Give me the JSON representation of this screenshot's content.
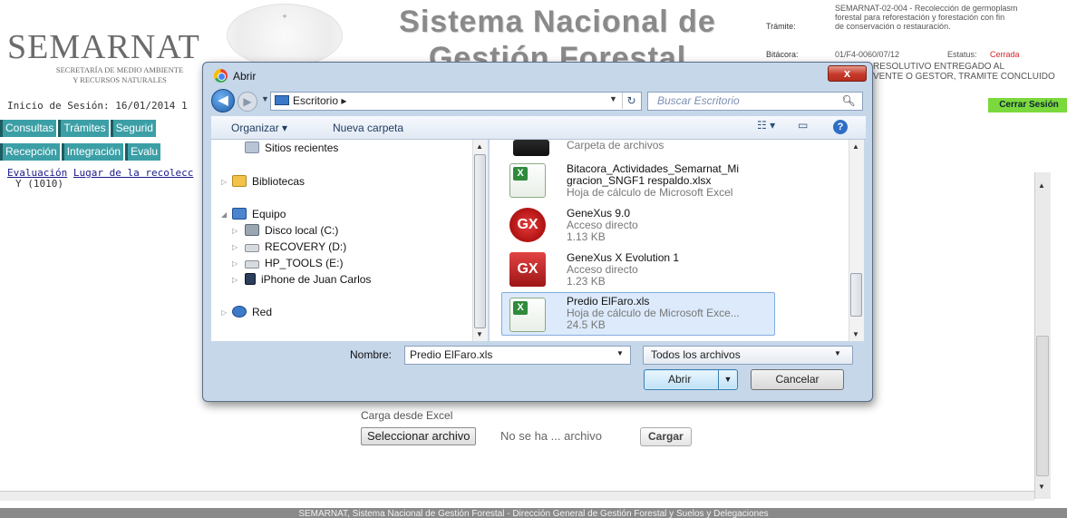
{
  "header": {
    "logo": "SEMARNAT",
    "logo_sub_line1": "SECRETARÍA DE MEDIO AMBIENTE",
    "logo_sub_line2": "Y RECURSOS NATURALES",
    "system_title_line1": "Sistema Nacional de",
    "system_title_line2": "Gestión Forestal",
    "tramite_label": "Trámite:",
    "tramite_value_line1": "SEMARNAT-02-004 - Recolección de germoplasm",
    "tramite_value_line2": "forestal para reforestación y forestación con fin",
    "tramite_value_line3": "de conservación o restauración.",
    "bitacora_label": "Bitácora:",
    "bitacora_value": "01/F4-0060/07/12",
    "estatus_label": "Estatus:",
    "estatus_value": "Cerrada",
    "resolutivo_line1": "RESOLUTIVO ENTREGADO AL",
    "resolutivo_line2": "VENTE O GESTOR, TRAMITE CONCLUIDO",
    "inicio_sesion": "Inicio de Sesión:  16/01/2014 1",
    "cerrar_sesion": "Cerrar Sesión"
  },
  "menu_primary": [
    "Consultas",
    "Trámites",
    "Segurid"
  ],
  "menu_secondary": [
    "Recepción",
    "Integración",
    "Evalu"
  ],
  "breadcrumb": {
    "link1": "Evaluación",
    "link2": "Lugar de la recolecc"
  },
  "page_text": {
    "y_code": "Y (1010)"
  },
  "carga": {
    "label": "Carga desde Excel",
    "select_button": "Seleccionar archivo",
    "no_file": "No se ha ... archivo",
    "cargar_button": "Cargar"
  },
  "footer": "SEMARNAT, Sistema Nacional de Gestión Forestal - Dirección General de Gestión Forestal y Suelos y Delegaciones",
  "dialog": {
    "title": "Abrir",
    "close_glyph": "x",
    "address": "Escritorio",
    "address_sep": "▸",
    "search_placeholder": "Buscar Escritorio",
    "organizar": "Organizar ▾",
    "nueva_carpeta": "Nueva carpeta",
    "help": "?",
    "nav_items": [
      {
        "label": "Sitios recientes"
      },
      {
        "label": "Bibliotecas"
      },
      {
        "label": "Equipo"
      },
      {
        "label": "Disco local (C:)"
      },
      {
        "label": "RECOVERY (D:)"
      },
      {
        "label": "HP_TOOLS (E:)"
      },
      {
        "label": "iPhone de Juan Carlos"
      },
      {
        "label": "Red"
      }
    ],
    "files": [
      {
        "name": "",
        "sub1": "Carpeta de archivos",
        "sub2": ""
      },
      {
        "name": "Bitacora_Actividades_Semarnat_Mi",
        "name2": "gracion_SNGF1 respaldo.xlsx",
        "sub1": "Hoja de cálculo de Microsoft Excel",
        "sub2": ""
      },
      {
        "name": "GeneXus 9.0",
        "sub1": "Acceso directo",
        "sub2": "1.13 KB"
      },
      {
        "name": "GeneXus X Evolution 1",
        "sub1": "Acceso directo",
        "sub2": "1.23 KB"
      },
      {
        "name": "Predio ElFaro.xls",
        "sub1": "Hoja de cálculo de Microsoft Exce...",
        "sub2": "24.5 KB"
      }
    ],
    "nombre_label": "Nombre:",
    "nombre_value": "Predio ElFaro.xls",
    "tipo_value": "Todos los archivos",
    "abrir_button": "Abrir",
    "cancelar_button": "Cancelar"
  }
}
